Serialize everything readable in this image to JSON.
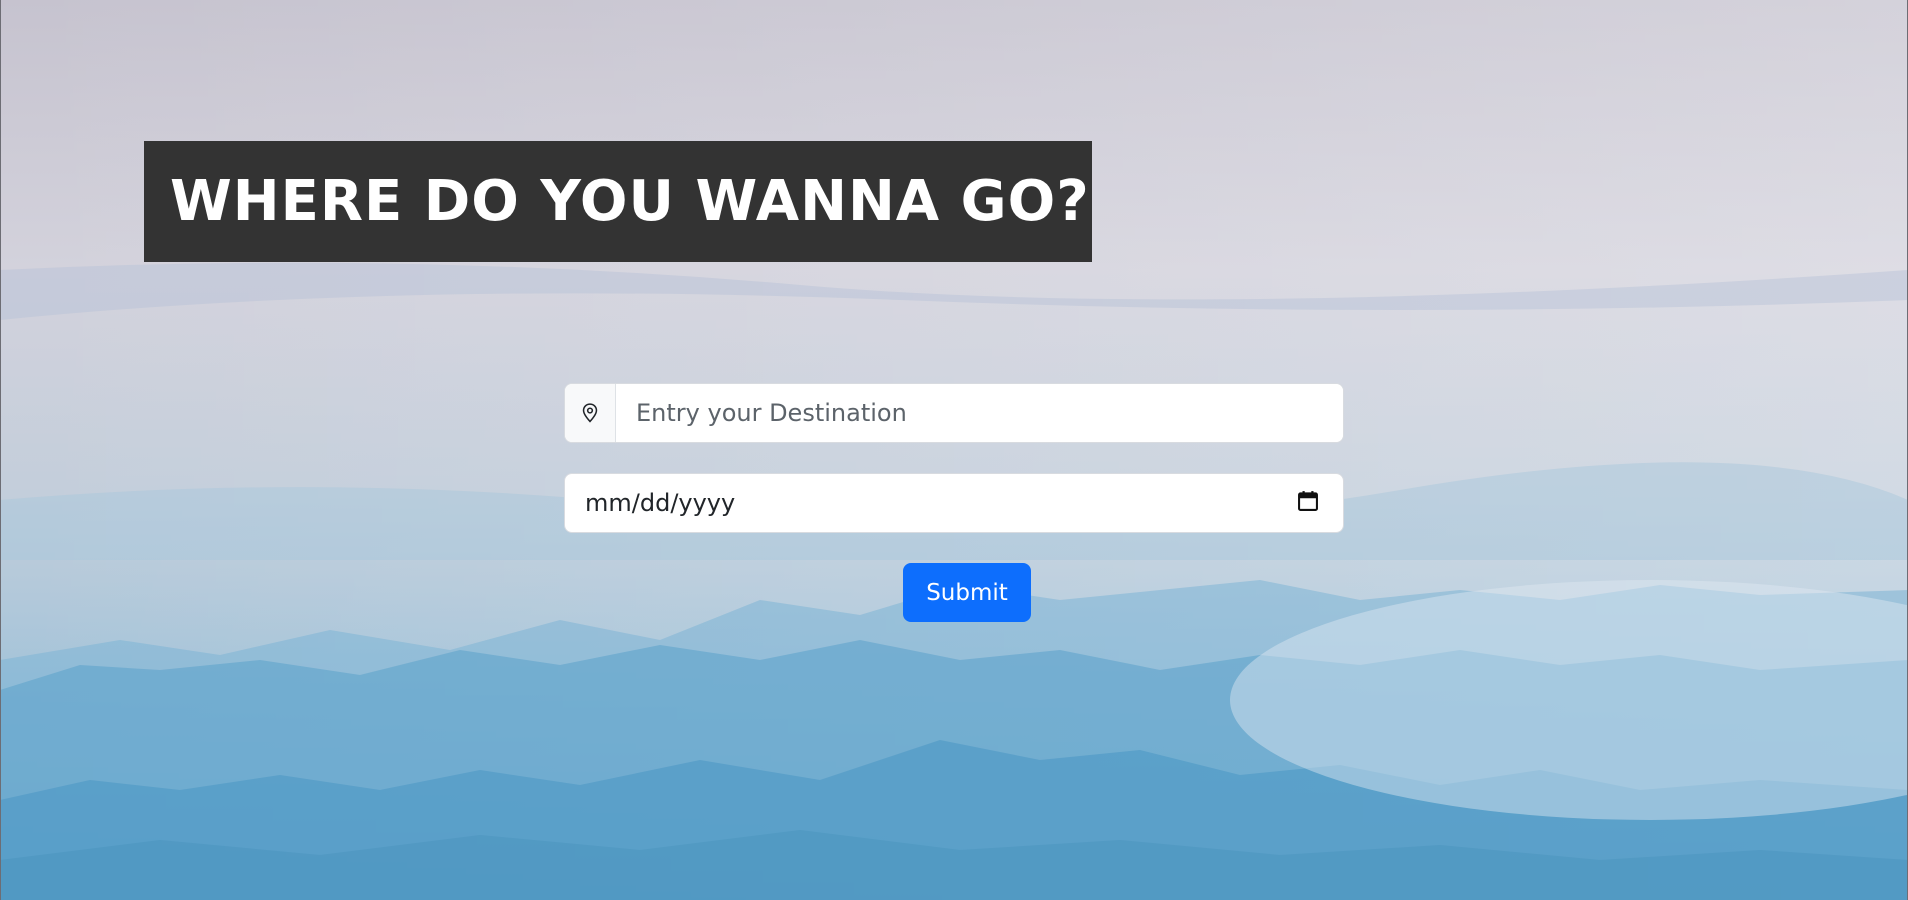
{
  "page": {
    "heading": "WHERE DO YOU WANNA GO?"
  },
  "form": {
    "destination": {
      "value": "",
      "placeholder": "Entry your Destination",
      "icon": "map-pin-icon"
    },
    "date": {
      "value": "mm/dd/yyyy",
      "icon": "calendar-icon"
    },
    "submit_label": "Submit"
  },
  "colors": {
    "heading_bg": "#333333",
    "heading_text": "#ffffff",
    "button_bg": "#0d6efd",
    "button_text": "#ffffff",
    "sky_top": "#c6c3cf",
    "mountains": "#4f9bc4"
  }
}
